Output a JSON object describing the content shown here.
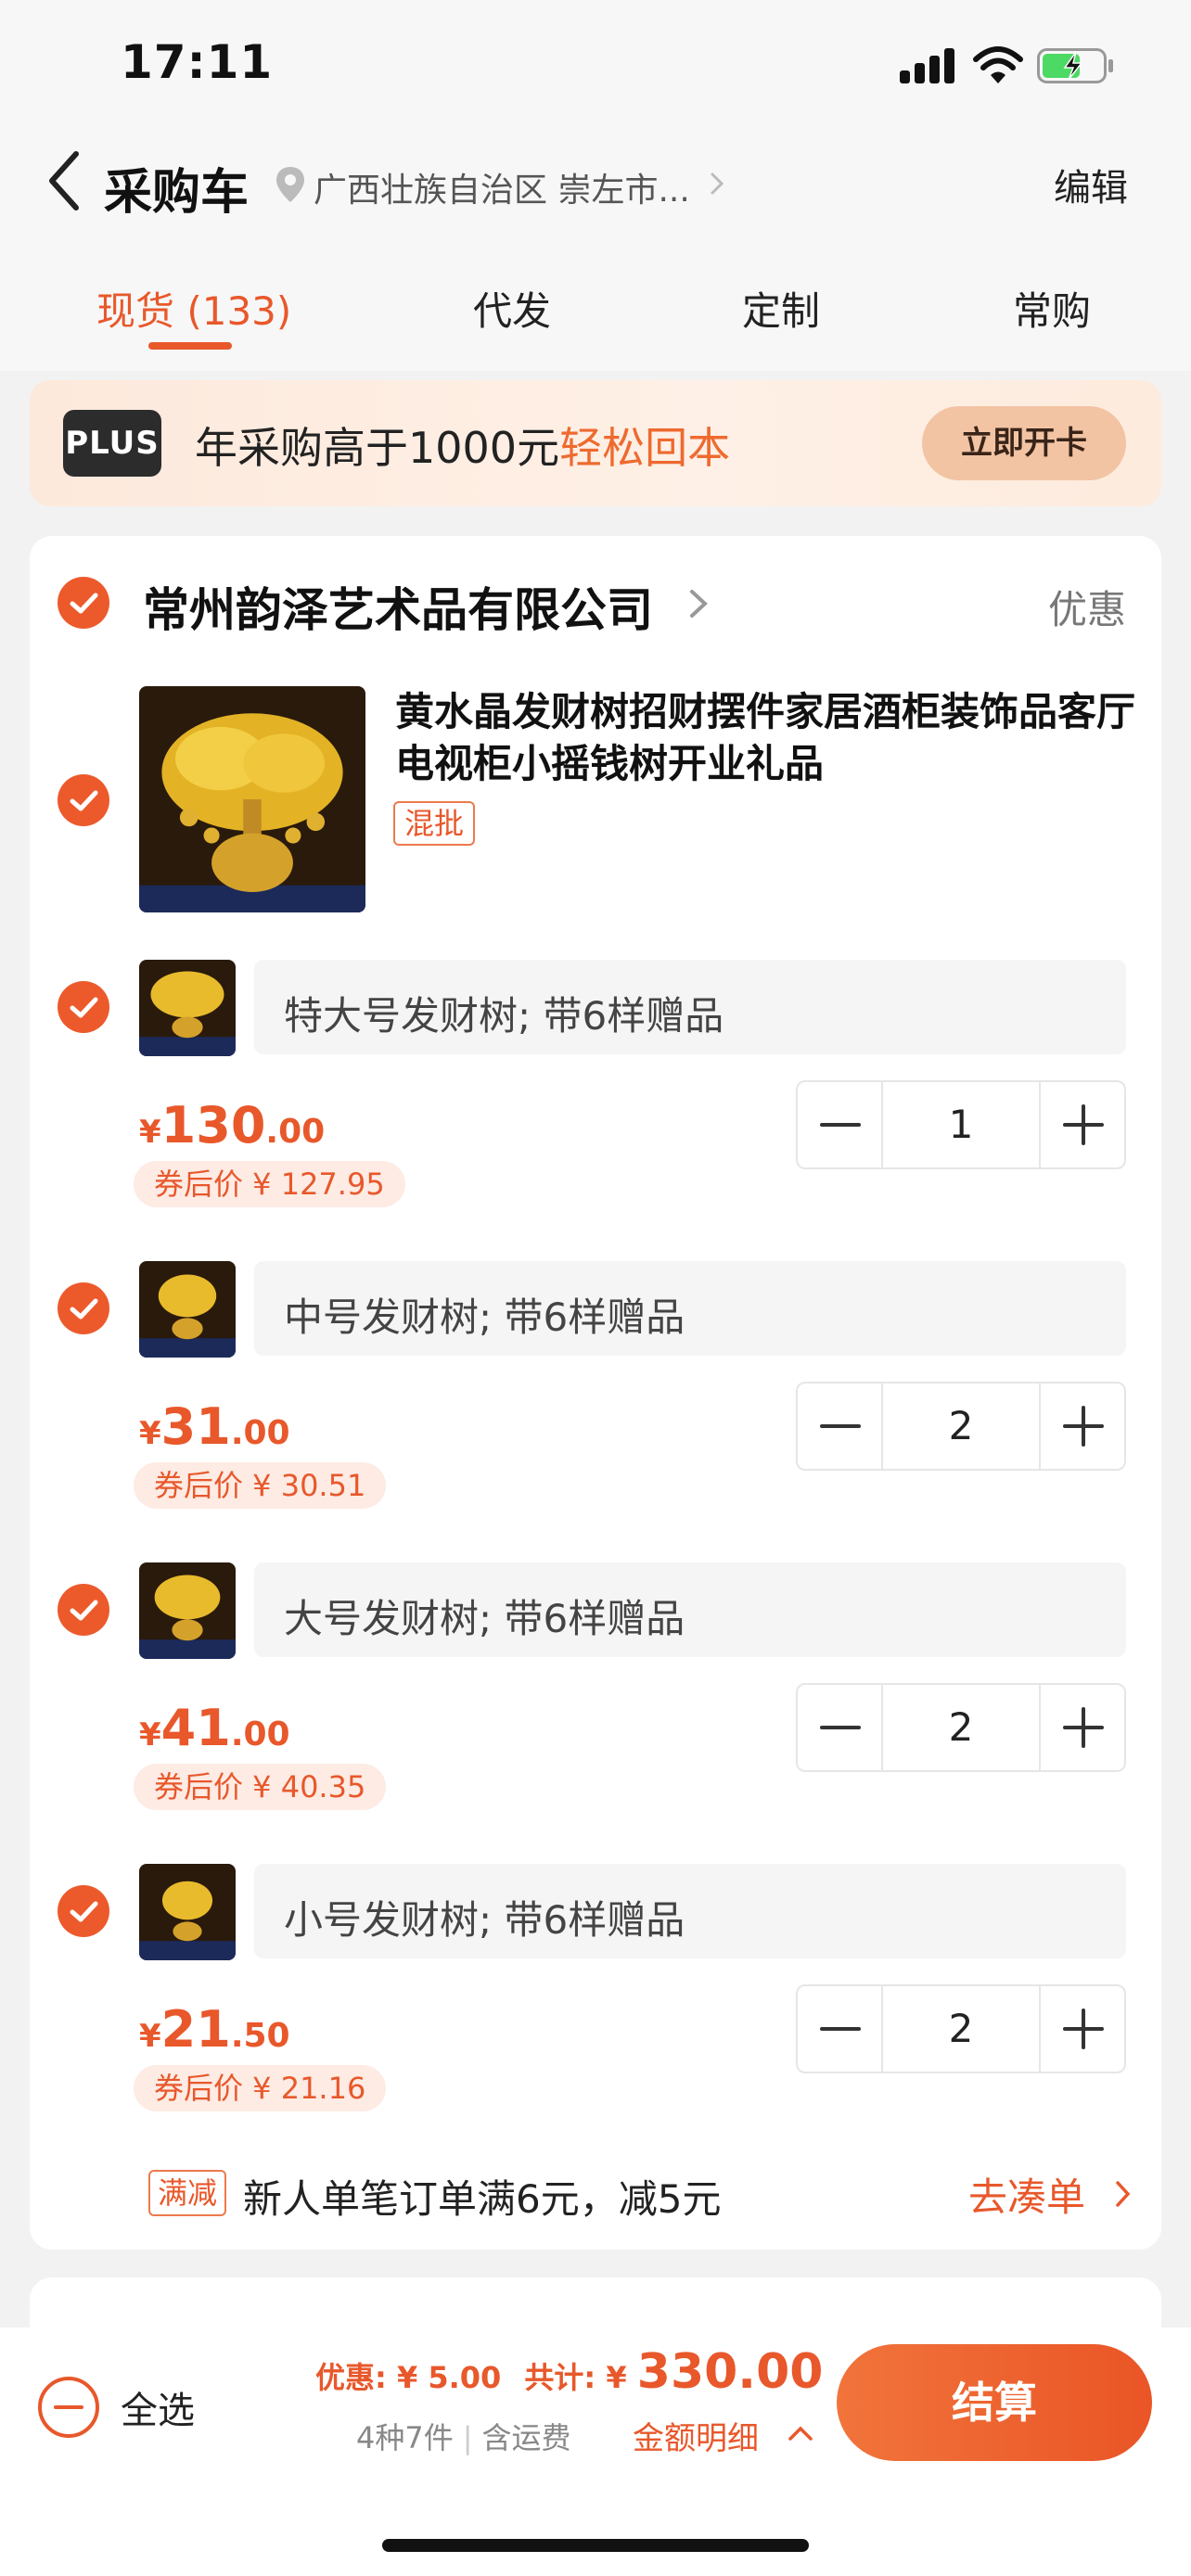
{
  "status_bar": {
    "time": "17:11"
  },
  "header": {
    "title": "采购车",
    "address": "广西壮族自治区 崇左市...",
    "edit_label": "编辑"
  },
  "tabs": [
    {
      "label": "现货 (133)",
      "active": true
    },
    {
      "label": "代发",
      "active": false
    },
    {
      "label": "定制",
      "active": false
    },
    {
      "label": "常购",
      "active": false
    }
  ],
  "plus_banner": {
    "badge": "PLUS",
    "text": "年采购高于1000元",
    "highlight": "轻松回本",
    "button": "立即开卡"
  },
  "shop": {
    "name": "常州韵泽艺术品有限公司",
    "promo_label": "优惠",
    "product": {
      "title": "黄水晶发财树招财摆件家居酒柜装饰品客厅电视柜小摇钱树开业礼品",
      "tag": "混批"
    },
    "skus": [
      {
        "name": "特大号发财树; 带6样赠品",
        "price_currency": "¥",
        "price_int": "130",
        "price_dec": ".00",
        "coupon": "券后价 ¥ 127.95",
        "quantity": "1"
      },
      {
        "name": "中号发财树; 带6样赠品",
        "price_currency": "¥",
        "price_int": "31",
        "price_dec": ".00",
        "coupon": "券后价 ¥ 30.51",
        "quantity": "2"
      },
      {
        "name": "大号发财树; 带6样赠品",
        "price_currency": "¥",
        "price_int": "41",
        "price_dec": ".00",
        "coupon": "券后价 ¥ 40.35",
        "quantity": "2"
      },
      {
        "name": "小号发财树; 带6样赠品",
        "price_currency": "¥",
        "price_int": "21",
        "price_dec": ".50",
        "coupon": "券后价 ¥ 21.16",
        "quantity": "2"
      }
    ],
    "discount": {
      "tag": "满减",
      "text": "新人单笔订单满6元，减5元",
      "link": "去凑单"
    }
  },
  "bottom_bar": {
    "select_all": "全选",
    "discount_label": "优惠: ¥ 5.00",
    "total_label": "共计: ¥ ",
    "total_value": "330.00",
    "count": "4种7件",
    "shipping": "含运费",
    "detail_link": "金额明细",
    "checkout": "结算"
  },
  "colors": {
    "accent": "#e8582b",
    "checkbox": "#ec5a2c",
    "banner_bg": "#fde9dc",
    "plus_button": "#f2c4a4"
  },
  "icons": [
    "back-arrow-icon",
    "location-pin-icon",
    "chevron-right-icon",
    "check-icon",
    "minus-icon",
    "plus-icon",
    "chevron-up-icon"
  ]
}
